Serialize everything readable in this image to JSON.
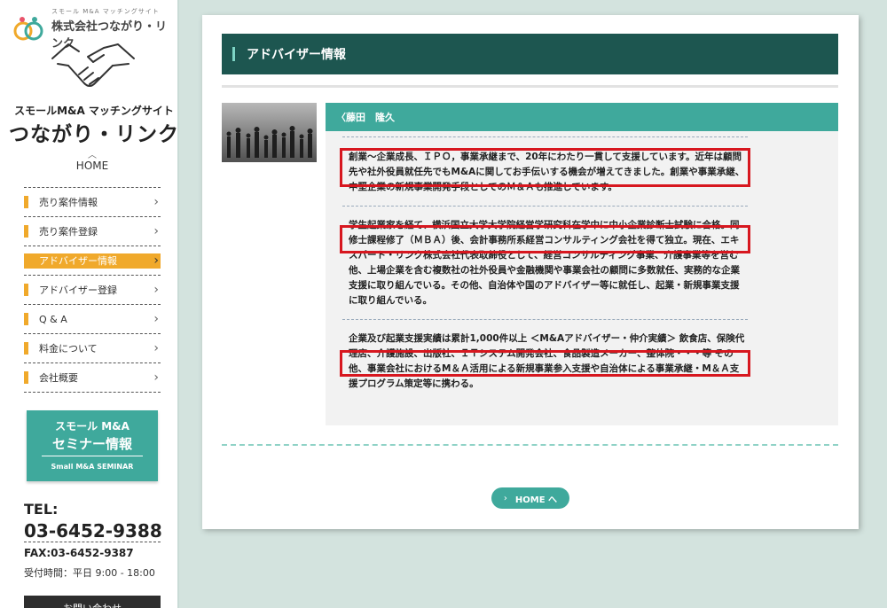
{
  "brand": {
    "small": "スモール M&A マッチングサイト",
    "name": "株式会社つながり・リンク"
  },
  "site": {
    "subtitle": "スモールM&A マッチングサイト",
    "title": "つながり・リンク",
    "home": "HOME"
  },
  "nav": [
    {
      "label": "売り案件情報",
      "active": false
    },
    {
      "label": "売り案件登録",
      "active": false
    },
    {
      "label": "アドバイザー情報",
      "active": true
    },
    {
      "label": "アドバイザー登録",
      "active": false
    },
    {
      "label": "Q & A",
      "active": false
    },
    {
      "label": "料金について",
      "active": false
    },
    {
      "label": "会社概要",
      "active": false
    }
  ],
  "seminar": {
    "line1": "スモール M&A",
    "line2": "セミナー情報",
    "line3": "Small M&A SEMINAR"
  },
  "contact": {
    "tel_label": "TEL:",
    "tel": "03-6452-9388",
    "fax": "FAX:03-6452-9387",
    "hours": "受付時間：平日 9:00 - 18:00",
    "button": "お問い合わせ"
  },
  "main": {
    "page_title": "アドバイザー情報",
    "advisor_name": "〈藤田　隆久",
    "paragraphs": [
      "創業～企業成長、ＩＰＯ，事業承継まで、20年にわたり一貫して支援しています。近年は顧問先や社外役員就任先でもM&Aに関してお手伝いする機会が増えてきました。創業や事業承継、中堅企業の新規事業開発手段としてのＭ＆Ａも推進しています。",
      "学生起業家を経て、横浜国立大学大学院経営学研究科在学中に中小企業診断士試験に合格。同修士課程修了（ＭＢＡ）後、会計事務所系経営コンサルティング会社を得て独立。現在、エキスパート・リンク株式会社代表取締役として、経営コンサルティング事業、介護事業等を営む他、上場企業を含む複数社の社外役員や金融機関や事業会社の顧問に多数就任、実務的な企業支援に取り組んでいる。その他、自治体や国のアドバイザー等に就任し、起業・新規事業支援に取り組んでいる。",
      "企業及び起業支援実績は累計1,000件以上 ＜M&Aアドバイザー・仲介実績＞ 飲食店、保険代理店、介護施設、出版社、ＩＴシステム開発会社、食品製造メーカー、整体院・・・等 その他、事業会社におけるM＆Ａ活用による新規事業参入支援や自治体による事業承継・M＆Ａ支援プログラム策定等に携わる。"
    ],
    "home_button": "HOME へ"
  },
  "colors": {
    "teal": "#3fa99c",
    "dark_teal": "#1d5650",
    "orange": "#f0a92b",
    "highlight_red": "#d7171f"
  }
}
